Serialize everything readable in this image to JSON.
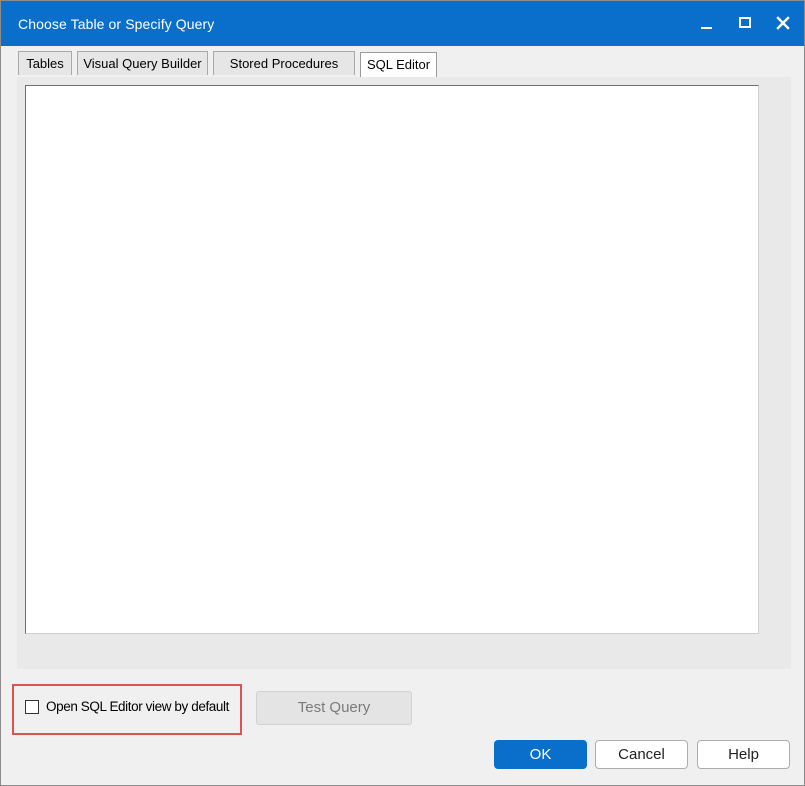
{
  "window": {
    "title": "Choose Table or Specify Query",
    "controls": {
      "minimize_icon": "minimize-icon",
      "maximize_icon": "maximize-icon",
      "close_icon": "close-icon"
    }
  },
  "tabs": [
    {
      "label": "Tables",
      "active": false
    },
    {
      "label": "Visual Query Builder",
      "active": false
    },
    {
      "label": "Stored Procedures",
      "active": false
    },
    {
      "label": "SQL Editor",
      "active": true
    }
  ],
  "editor": {
    "value": ""
  },
  "footer": {
    "default_view_checkbox": {
      "label": "Open SQL Editor view by default",
      "checked": false
    },
    "test_query_label": "Test Query",
    "ok_label": "OK",
    "cancel_label": "Cancel",
    "help_label": "Help"
  },
  "colors": {
    "accent": "#0a6fcb",
    "highlight": "#e05252"
  }
}
